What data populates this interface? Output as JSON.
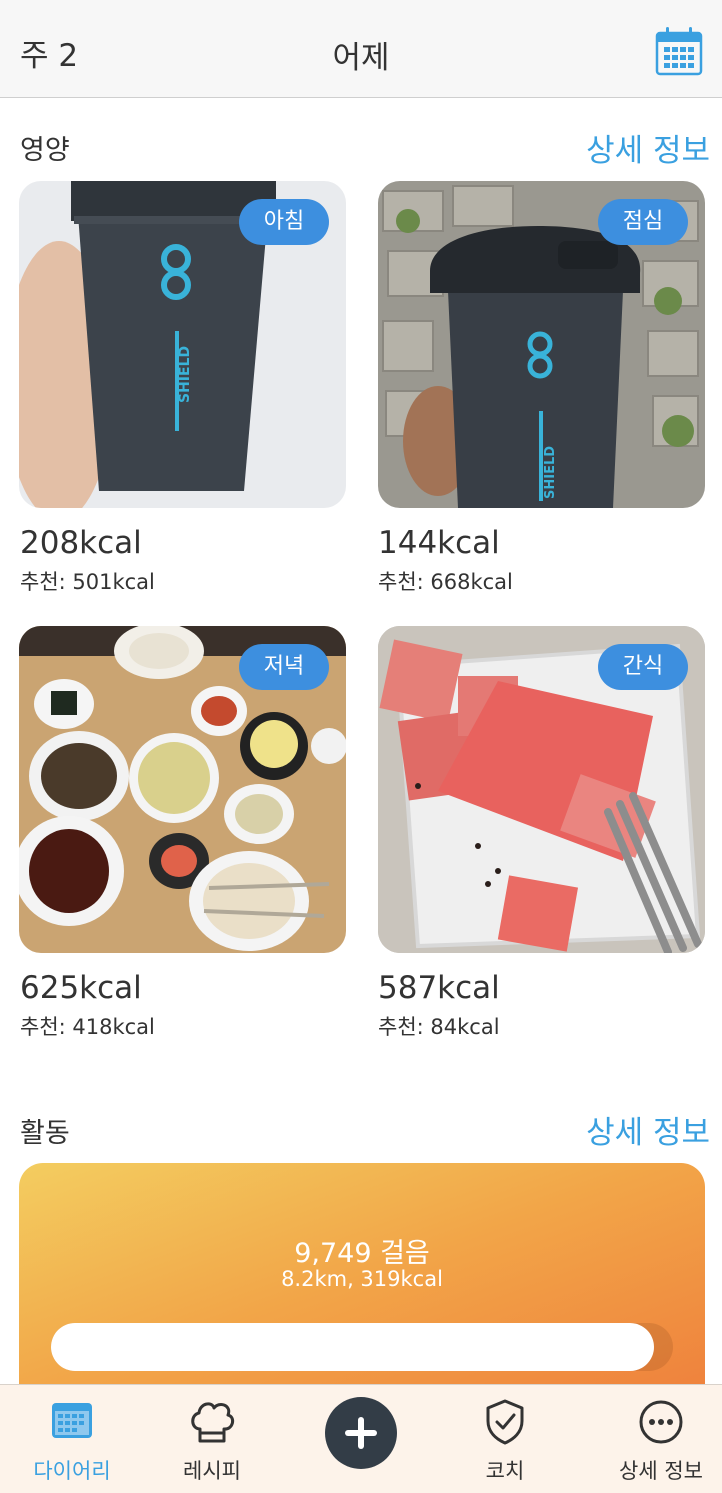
{
  "header": {
    "week": "주 2",
    "title": "어제",
    "calendar_icon": "calendar-icon"
  },
  "nutrition": {
    "title": "영양",
    "more": "상세 정보",
    "meals": [
      {
        "badge": "아침",
        "kcal": "208kcal",
        "recommended": "추천: 501kcal",
        "photo": "dark protein shaker with SHIELD logo"
      },
      {
        "badge": "점심",
        "kcal": "144kcal",
        "recommended": "추천: 668kcal",
        "photo": "Blender Bottle shaker over paving stones"
      },
      {
        "badge": "저녁",
        "kcal": "625kcal",
        "recommended": "추천: 418kcal",
        "photo": "Korean meal with rice and side dishes"
      },
      {
        "badge": "간식",
        "kcal": "587kcal",
        "recommended": "추천: 84kcal",
        "photo": "watermelon cubes with a fork"
      }
    ]
  },
  "activity": {
    "title": "활동",
    "more": "상세 정보",
    "steps": "9,749 걸음",
    "summary": "8.2km, 319kcal",
    "progress": 0.97
  },
  "tabbar": {
    "items": [
      {
        "label": "다이어리",
        "icon": "diary-calendar-icon",
        "active": true
      },
      {
        "label": "레시피",
        "icon": "chef-hat-icon",
        "active": false
      },
      {
        "label": "",
        "icon": "plus-icon",
        "active": false
      },
      {
        "label": "코치",
        "icon": "shield-check-icon",
        "active": false
      },
      {
        "label": "상세 정보",
        "icon": "more-dots-icon",
        "active": false
      }
    ]
  },
  "colors": {
    "accent": "#3aa0e0",
    "badge": "#3d8fdf",
    "fab": "#333d47",
    "tab_active": "#3aa0e0"
  }
}
